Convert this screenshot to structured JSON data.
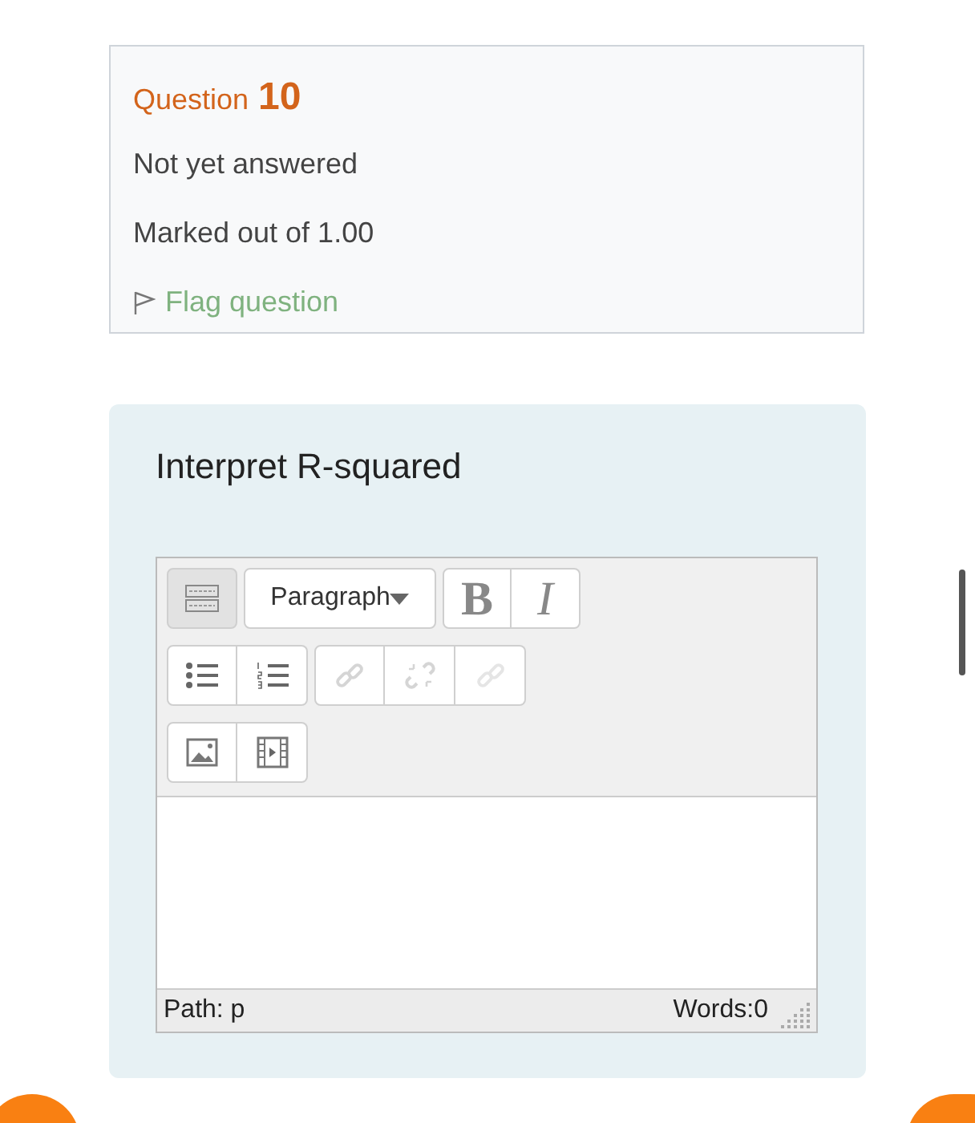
{
  "question_info": {
    "label": "Question",
    "number": "10",
    "status": "Not yet answered",
    "marks": "Marked out of 1.00",
    "flag_link": "Flag question"
  },
  "formulation": {
    "prompt": "Interpret R-squared",
    "editor": {
      "toolbar_rows": [
        [
          {
            "kind": "toggle",
            "active": true,
            "disabled": false
          },
          {
            "kind": "format_select",
            "text": "Paragraph",
            "active": false,
            "disabled": false
          },
          {
            "kind": "bold",
            "text": "B",
            "active": false,
            "disabled": false
          },
          {
            "kind": "italic",
            "text": "I",
            "active": false,
            "disabled": false
          }
        ],
        [
          {
            "kind": "bullet_list",
            "active": false,
            "disabled": false
          },
          {
            "kind": "number_list",
            "active": false,
            "disabled": false
          },
          {
            "kind": "link",
            "active": false,
            "disabled": true
          },
          {
            "kind": "unlink",
            "active": false,
            "disabled": true
          },
          {
            "kind": "anchor",
            "active": false,
            "disabled": true
          }
        ],
        [
          {
            "kind": "image",
            "active": false,
            "disabled": false
          },
          {
            "kind": "media",
            "active": false,
            "disabled": false
          }
        ]
      ],
      "path": "Path: p",
      "words": "Words:0"
    }
  }
}
